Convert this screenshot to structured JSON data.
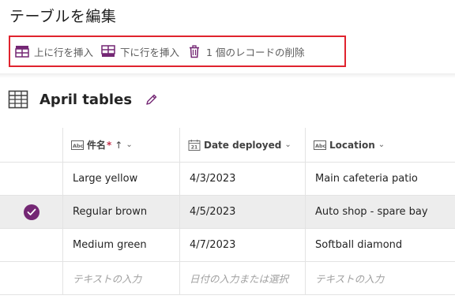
{
  "page": {
    "title": "テーブルを編集"
  },
  "toolbar": {
    "insert_above": "上に行を挿入",
    "insert_below": "下に行を挿入",
    "delete": "1 個のレコードの削除"
  },
  "table": {
    "name": "April tables",
    "columns": [
      {
        "label": "件名",
        "type_icon": "text-type-icon",
        "required": "*",
        "sort": "↑",
        "chevron": "⌄"
      },
      {
        "label": "Date deployed",
        "type_icon": "calendar-icon",
        "calendar_day": "21",
        "chevron": "⌄"
      },
      {
        "label": "Location",
        "type_icon": "text-type-icon",
        "chevron": "⌄"
      }
    ],
    "rows": [
      {
        "name": "Large yellow",
        "date": "4/3/2023",
        "location": "Main cafeteria patio"
      },
      {
        "name": "Regular brown",
        "date": "4/5/2023",
        "location": "Auto shop - spare bay",
        "selected": true
      },
      {
        "name": "Medium green",
        "date": "4/7/2023",
        "location": "Softball diamond"
      }
    ],
    "new_row_placeholders": {
      "name": "テキストの入力",
      "date": "日付の入力または選択",
      "location": "テキストの入力"
    }
  },
  "colors": {
    "accent": "#742774",
    "highlight_border": "#e0232e",
    "icon": "#742774"
  }
}
